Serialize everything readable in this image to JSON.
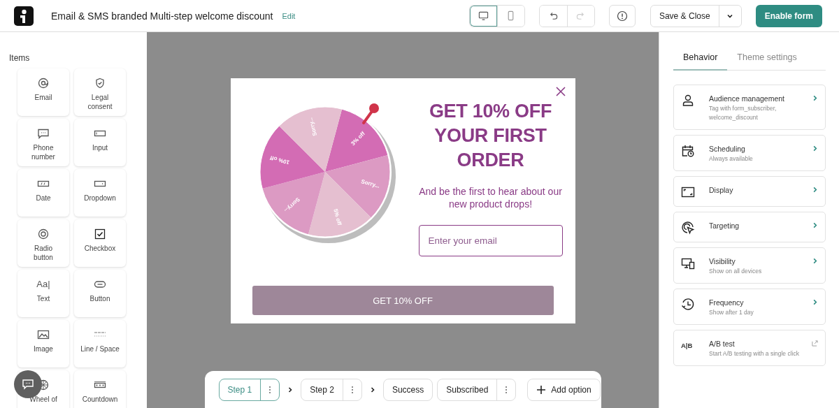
{
  "header": {
    "title": "Email & SMS branded Multi-step welcome discount",
    "edit_link": "Edit",
    "device_toggle": [
      {
        "kind": "desktop",
        "selected": true
      },
      {
        "kind": "mobile",
        "selected": false
      }
    ],
    "history": [
      {
        "kind": "undo",
        "disabled": false
      },
      {
        "kind": "redo",
        "disabled": true
      }
    ],
    "save_button": "Save & Close",
    "enable_button": "Enable form"
  },
  "sidebar": {
    "heading": "Items",
    "items": [
      {
        "kind": "email",
        "label": "Email"
      },
      {
        "kind": "legal",
        "label": "Legal consent"
      },
      {
        "kind": "phone",
        "label": "Phone number"
      },
      {
        "kind": "input",
        "label": "Input"
      },
      {
        "kind": "date",
        "label": "Date"
      },
      {
        "kind": "dropdown",
        "label": "Dropdown"
      },
      {
        "kind": "radio",
        "label": "Radio button"
      },
      {
        "kind": "checkbox",
        "label": "Checkbox"
      },
      {
        "kind": "text",
        "label": "Text",
        "icon_text": "Aa|"
      },
      {
        "kind": "button",
        "label": "Button"
      },
      {
        "kind": "image",
        "label": "Image"
      },
      {
        "kind": "line",
        "label": "Line / Space"
      },
      {
        "kind": "wheel",
        "label": "Wheel of"
      },
      {
        "kind": "countdown",
        "label": "Countdown"
      }
    ]
  },
  "popup": {
    "wheel": {
      "segments": [
        {
          "label": "3% off",
          "color": "#d36cb4"
        },
        {
          "label": "Sorry...",
          "color": "#dc9ac3"
        },
        {
          "label": "5% off",
          "color": "#e5bfd0"
        },
        {
          "label": "Sorry...",
          "color": "#dc9ac3"
        },
        {
          "label": "10% off",
          "color": "#d36cb4"
        },
        {
          "label": "Sorry...",
          "color": "#e5bfd0"
        }
      ]
    },
    "headline": "GET 10% OFF YOUR FIRST ORDER",
    "subtext": "And be the first to hear about our new product drops!",
    "email_field": {
      "placeholder": "Enter your email"
    },
    "button": "GET 10% OFF"
  },
  "steps": [
    {
      "label": "Step 1",
      "selected": true,
      "has_menu": true
    },
    {
      "label": "Step 2",
      "selected": false,
      "has_menu": true
    },
    {
      "label": "Success",
      "selected": false,
      "has_menu": false
    },
    {
      "label": "Subscribed",
      "selected": false,
      "has_menu": true
    }
  ],
  "add_option": "Add option",
  "panel": {
    "tabs": [
      {
        "label": "Behavior",
        "selected": true
      },
      {
        "label": "Theme settings",
        "selected": false
      }
    ],
    "cards": [
      {
        "kind": "audience",
        "title": "Audience management",
        "subtitle": "Tag with form_subscriber, welcome_discount",
        "external": false
      },
      {
        "kind": "scheduling",
        "title": "Scheduling",
        "subtitle": "Always available",
        "external": false
      },
      {
        "kind": "display",
        "title": "Display",
        "external": false
      },
      {
        "kind": "targeting",
        "title": "Targeting",
        "external": false
      },
      {
        "kind": "visibility",
        "title": "Visibility",
        "subtitle": "Show on all devices",
        "external": false
      },
      {
        "kind": "frequency",
        "title": "Frequency",
        "subtitle": "Show after 1 day",
        "external": false
      },
      {
        "kind": "abtest",
        "title": "A/B test",
        "subtitle": "Start A/B testing with a single click",
        "external": true,
        "icon_text": "A|B"
      }
    ]
  }
}
